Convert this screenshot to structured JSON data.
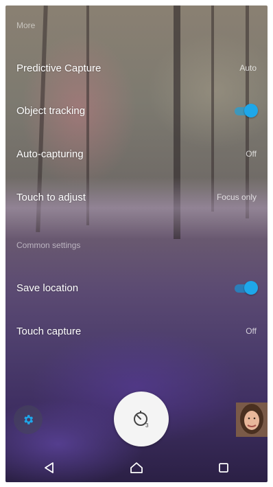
{
  "more_section": {
    "header": "More",
    "items": [
      {
        "label": "Predictive Capture",
        "value": "Auto"
      },
      {
        "label": "Object tracking",
        "toggle_on": true
      },
      {
        "label": "Auto-capturing",
        "value": "Off"
      },
      {
        "label": "Touch to adjust",
        "value": "Focus only"
      }
    ]
  },
  "common_section": {
    "header": "Common settings",
    "items": [
      {
        "label": "Save location",
        "toggle_on": true
      },
      {
        "label": "Touch capture",
        "value": "Off"
      }
    ]
  },
  "controls": {
    "settings_icon": "gear-icon",
    "shutter_icon": "self-timer-icon",
    "thumbnail_icon": "photo-thumbnail"
  },
  "nav": {
    "back_icon": "back-triangle-icon",
    "home_icon": "home-icon",
    "recents_icon": "recents-square-icon"
  },
  "colors": {
    "accent": "#1ea7ea"
  }
}
